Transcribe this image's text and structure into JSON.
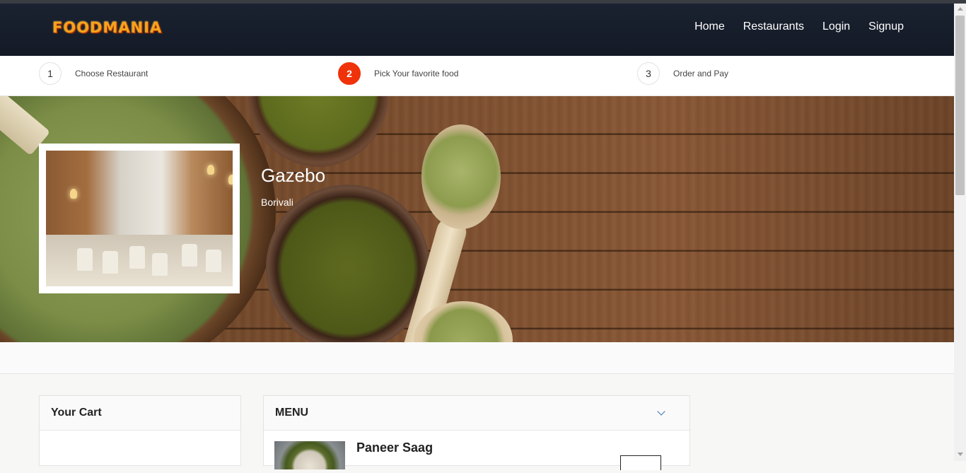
{
  "brand": {
    "logo_text": "FOODMANIA"
  },
  "nav": {
    "home": "Home",
    "restaurants": "Restaurants",
    "login": "Login",
    "signup": "Signup"
  },
  "steps": [
    {
      "number": "1",
      "label": "Choose Restaurant",
      "active": false
    },
    {
      "number": "2",
      "label": "Pick Your favorite food",
      "active": true
    },
    {
      "number": "3",
      "label": "Order and Pay",
      "active": false
    }
  ],
  "restaurant": {
    "name": "Gazebo",
    "location": "Borivali"
  },
  "cart": {
    "title": "Your Cart"
  },
  "menu": {
    "title": "MENU",
    "items": [
      {
        "name": "Paneer Saag"
      }
    ]
  },
  "colors": {
    "accent": "#f0320a",
    "navbar": "#1a2230",
    "logo": "#f7a21b",
    "chevron": "#3b6fb0"
  }
}
